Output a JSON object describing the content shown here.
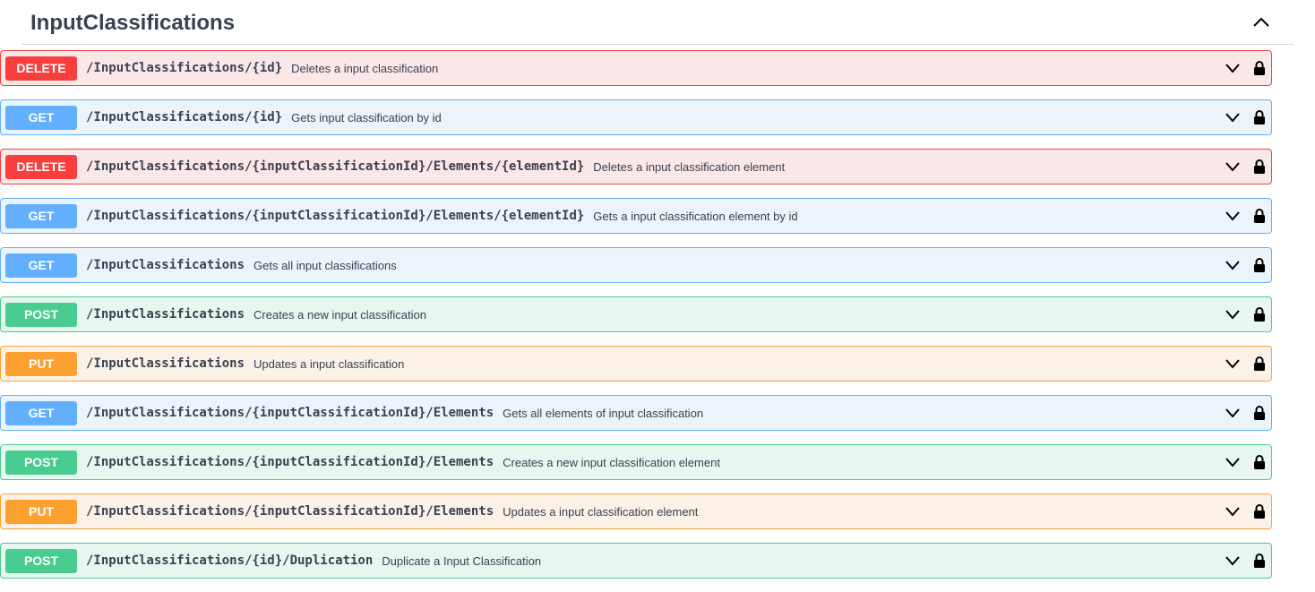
{
  "section": {
    "title": "InputClassifications",
    "collapse_icon": "chevron-up-icon"
  },
  "operations": [
    {
      "method": "DELETE",
      "path": "/InputClassifications/{id}",
      "summary": "Deletes a input classification"
    },
    {
      "method": "GET",
      "path": "/InputClassifications/{id}",
      "summary": "Gets input classification by id"
    },
    {
      "method": "DELETE",
      "path": "/InputClassifications/{inputClassificationId}/Elements/{elementId}",
      "summary": "Deletes a input classification element"
    },
    {
      "method": "GET",
      "path": "/InputClassifications/{inputClassificationId}/Elements/{elementId}",
      "summary": "Gets a input classification element by id"
    },
    {
      "method": "GET",
      "path": "/InputClassifications",
      "summary": "Gets all input classifications"
    },
    {
      "method": "POST",
      "path": "/InputClassifications",
      "summary": "Creates a new input classification"
    },
    {
      "method": "PUT",
      "path": "/InputClassifications",
      "summary": "Updates a input classification"
    },
    {
      "method": "GET",
      "path": "/InputClassifications/{inputClassificationId}/Elements",
      "summary": "Gets all elements of input classification"
    },
    {
      "method": "POST",
      "path": "/InputClassifications/{inputClassificationId}/Elements",
      "summary": "Creates a new input classification element"
    },
    {
      "method": "PUT",
      "path": "/InputClassifications/{inputClassificationId}/Elements",
      "summary": "Updates a input classification element"
    },
    {
      "method": "POST",
      "path": "/InputClassifications/{id}/Duplication",
      "summary": "Duplicate a Input Classification"
    }
  ],
  "colors": {
    "DELETE": "#f93e3e",
    "GET": "#61affe",
    "POST": "#49cc90",
    "PUT": "#fca130"
  },
  "icons": {
    "expand": "chevron-down-icon",
    "auth": "lock-icon"
  }
}
